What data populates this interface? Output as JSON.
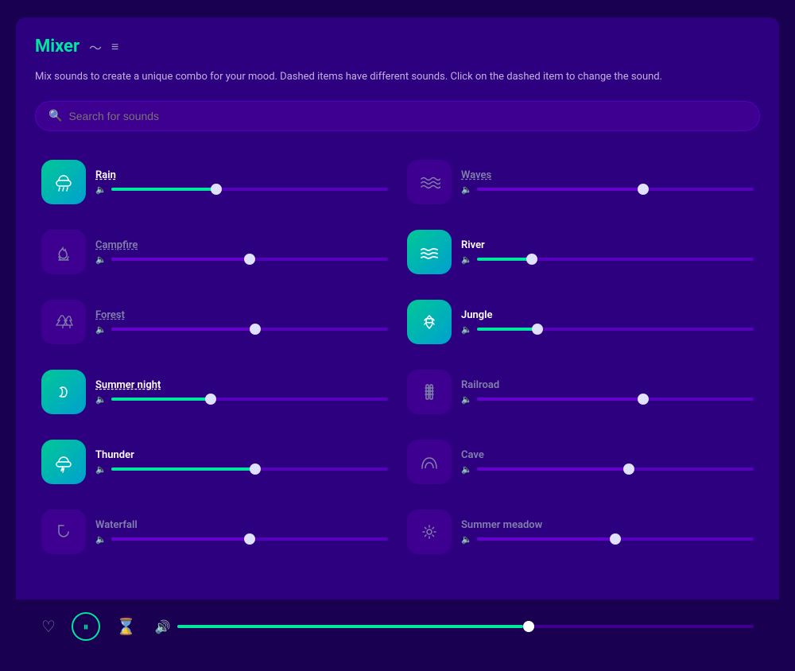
{
  "app": {
    "title": "Mixer",
    "subtitle": "Mix sounds to create a unique combo for your mood. Dashed items have different sounds. Click on the dashed item to change the sound."
  },
  "search": {
    "placeholder": "Search for sounds"
  },
  "sounds": [
    {
      "id": "rain",
      "name": "Rain",
      "active": true,
      "dashed": true,
      "icon": "🌧",
      "sliderPercent": 38,
      "col": 0
    },
    {
      "id": "waves",
      "name": "Waves",
      "active": false,
      "dashed": true,
      "icon": "🌊",
      "sliderPercent": 60,
      "col": 1
    },
    {
      "id": "campfire",
      "name": "Campfire",
      "active": false,
      "dashed": true,
      "icon": "🔥",
      "sliderPercent": 50,
      "col": 0
    },
    {
      "id": "river",
      "name": "River",
      "active": true,
      "dashed": false,
      "icon": "〜",
      "sliderPercent": 20,
      "col": 1
    },
    {
      "id": "forest",
      "name": "Forest",
      "active": false,
      "dashed": true,
      "icon": "🌲",
      "sliderPercent": 52,
      "col": 0
    },
    {
      "id": "jungle",
      "name": "Jungle",
      "active": true,
      "dashed": false,
      "icon": "🌿",
      "sliderPercent": 22,
      "col": 1
    },
    {
      "id": "summer-night",
      "name": "Summer night",
      "active": true,
      "dashed": true,
      "icon": "🌙",
      "sliderPercent": 36,
      "col": 0
    },
    {
      "id": "railroad",
      "name": "Railroad",
      "active": false,
      "dashed": false,
      "icon": "🛤",
      "sliderPercent": 60,
      "col": 1
    },
    {
      "id": "thunder",
      "name": "Thunder",
      "active": true,
      "dashed": false,
      "icon": "⛈",
      "sliderPercent": 52,
      "col": 0
    },
    {
      "id": "cave",
      "name": "Cave",
      "active": false,
      "dashed": false,
      "icon": "🏔",
      "sliderPercent": 55,
      "col": 1
    },
    {
      "id": "waterfall",
      "name": "Waterfall",
      "active": false,
      "dashed": false,
      "icon": "💦",
      "sliderPercent": 50,
      "col": 0
    },
    {
      "id": "summer-meadow",
      "name": "Summer meadow",
      "active": false,
      "dashed": false,
      "icon": "🌸",
      "sliderPercent": 50,
      "col": 1
    }
  ],
  "player": {
    "volumePercent": 60
  }
}
